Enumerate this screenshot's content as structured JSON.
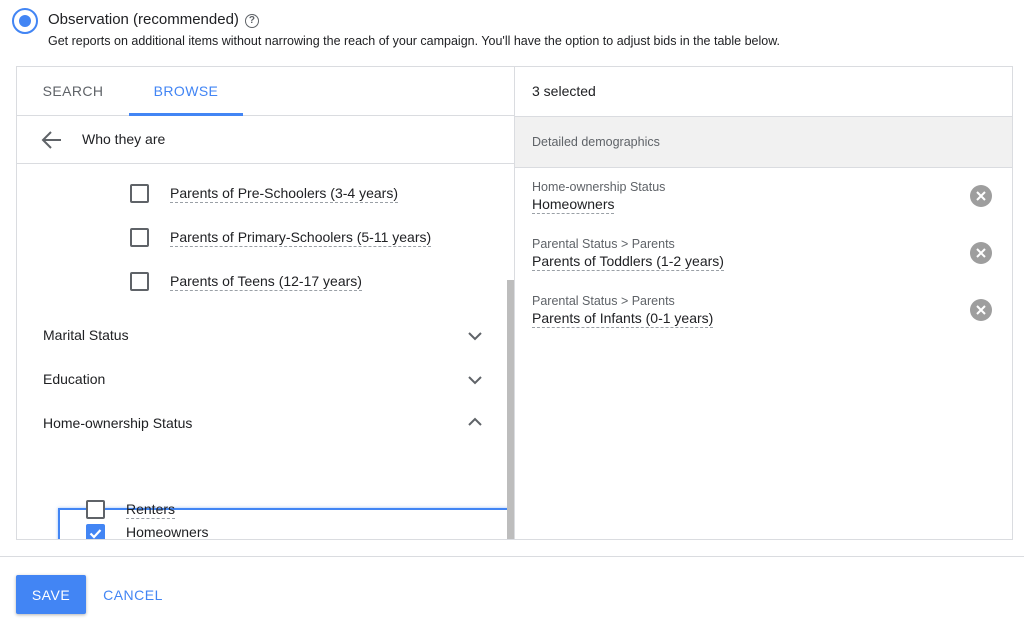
{
  "observation": {
    "title": "Observation (recommended)",
    "description": "Get reports on additional items without narrowing the reach of your campaign. You'll have the option to adjust bids in the table below.",
    "help_glyph": "?"
  },
  "tabs": [
    {
      "label": "SEARCH",
      "active": false
    },
    {
      "label": "BROWSE",
      "active": true
    }
  ],
  "breadcrumb": {
    "label": "Who they are"
  },
  "list": {
    "parental_items": [
      {
        "label": "Parents of Pre-Schoolers (3-4 years)",
        "checked": false
      },
      {
        "label": "Parents of Primary-Schoolers (5-11 years)",
        "checked": false
      },
      {
        "label": "Parents of Teens (12-17 years)",
        "checked": false
      }
    ],
    "sections": [
      {
        "label": "Marital Status",
        "expanded": false
      },
      {
        "label": "Education",
        "expanded": false
      },
      {
        "label": "Home-ownership Status",
        "expanded": true
      }
    ],
    "homeownership_items": [
      {
        "label": "Homeowners",
        "checked": true
      },
      {
        "label": "Renters",
        "checked": false
      }
    ]
  },
  "selected": {
    "count_label": "3 selected",
    "header": "Detailed demographics",
    "items": [
      {
        "category": "Home-ownership Status",
        "value": "Homeowners"
      },
      {
        "category": "Parental Status > Parents",
        "value": "Parents of Toddlers (1-2 years)"
      },
      {
        "category": "Parental Status > Parents",
        "value": "Parents of Infants (0-1 years)"
      }
    ]
  },
  "footer": {
    "save_label": "SAVE",
    "cancel_label": "CANCEL"
  },
  "colors": {
    "accent": "#4285f4",
    "text": "#202124",
    "muted": "#5f6368",
    "border": "#dadce0"
  }
}
